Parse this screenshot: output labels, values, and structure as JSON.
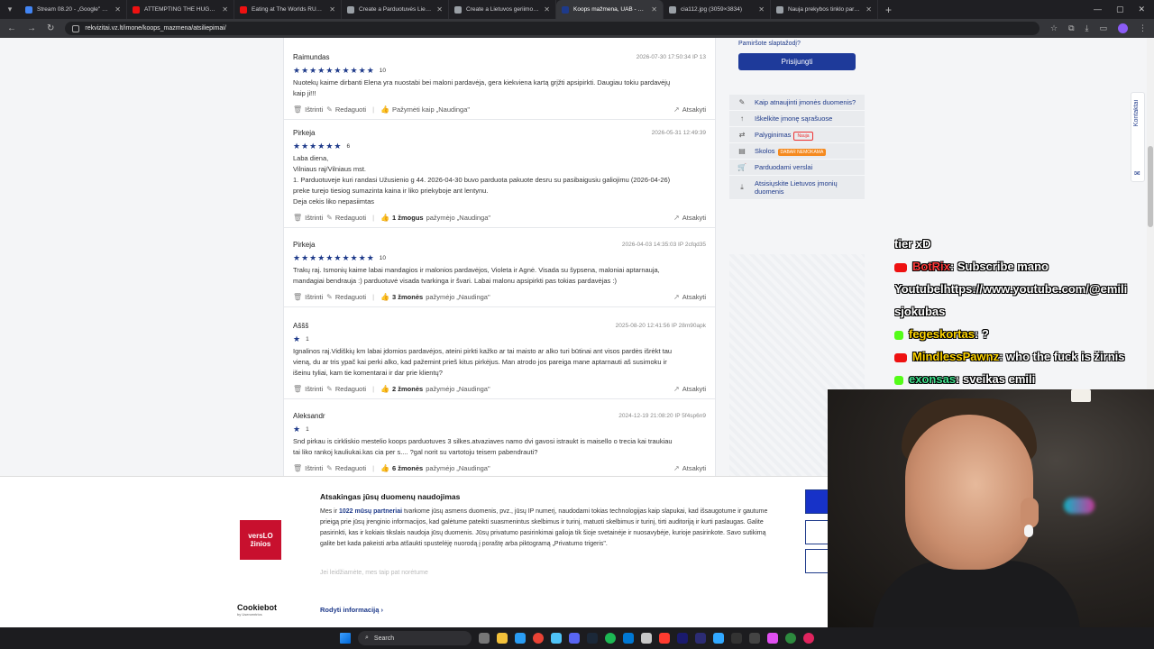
{
  "browser": {
    "tabs": [
      {
        "title": "Stream 08.20 - „Google\" dokum",
        "color": "#4285f4",
        "active": false
      },
      {
        "title": "ATTEMPTING THE HUGE EATIN",
        "color": "#e11",
        "active": false
      },
      {
        "title": "Eating at The Worlds RUDEST R",
        "color": "#e11",
        "active": false
      },
      {
        "title": "Create a Parduotuvės Lietuvoje",
        "color": "#9aa0a6",
        "active": false
      },
      {
        "title": "Create a Lietuvos geriimo Tier Li",
        "color": "#9aa0a6",
        "active": false
      },
      {
        "title": "Koops mažmena, UAB - atsilie",
        "color": "#1e3a8a",
        "active": true
      },
      {
        "title": "cia112.jpg (3059×3834)",
        "color": "#9aa0a6",
        "active": false
      },
      {
        "title": "Nauja prekybos tinklo parduot",
        "color": "#9aa0a6",
        "active": false
      }
    ],
    "url": "rekvizitai.vz.lt/imone/koops_mazmena/atsiliepimai/"
  },
  "reviews": [
    {
      "name": "Raimundas",
      "date": "2026-07-30 17:50:34",
      "ip": "IP 13",
      "stars": 10,
      "score": "10",
      "text": "Nuotekų kaime dirbanti Elena yra nuostabi bei maloni pardavėja, gera kiekviena kartą grįžti apsipirkti. Daugiau tokiu pardavėjų\nkaip ji!!!",
      "helpful_count": "",
      "helpful_text": "Pažymėti kaip „Naudinga\""
    },
    {
      "name": "Pirkeja",
      "date": "2026-05-31 12:49:39",
      "ip": "",
      "stars": 6,
      "score": "6",
      "text": "Laba diena,\nVilniaus raj/Vilniaus mst.\n1. Parduotuveje kuri randasi Užusienio g 44. 2026-04-30 buvo parduota pakuote desru su pasibaigusiu galiojimu (2026-04-26)\npreke turejo tiesiog sumazinta kaina ir liko priekyboje ant lentynu.\nDeja cekis liko nepasiimtas",
      "helpful_count": "1 žmogus",
      "helpful_text": "pažymėjo „Naudinga\""
    },
    {
      "name": "Pirkeja",
      "date": "2026-04-03 14:35:03",
      "ip": "IP 2cfqd35",
      "stars": 10,
      "score": "10",
      "text": "Trakų raj. Ismonių kaime labai mandagios ir malonios pardavėjos, Violeta ir Agnė. Visada su šypsena, maloniai aptarnauja,\nmandagiai bendrauja :) parduotuvė visada tvarkinga ir švari. Labai malonu apsipirkti pas tokias pardavėjas :)",
      "helpful_count": "3 žmonės",
      "helpful_text": "pažymėjo „Naudinga\""
    },
    {
      "name": "Aššš",
      "date": "2025-08-20 12:41:56",
      "ip": "IP 28m90apk",
      "stars": 1,
      "score": "1",
      "text": "Ignalinos raj.Vidiškių km labai įdomios pardavėjos, ateini pirkti kažko ar tai maisto ar alko turi būtinai ant visos pardės išrėkt tau\nvieną, du ar tris ypač kai perki alko, kad pažemint prieš kitus pirkėjus. Man atrodo jos pareiga mane aptarnauti aš susimoku ir\nišeinu tyliai, kam tie komentarai ir dar prie klientų?",
      "helpful_count": "2 žmonės",
      "helpful_text": "pažymėjo „Naudinga\""
    },
    {
      "name": "Aleksandr",
      "date": "2024-12-19 21:08:20",
      "ip": "IP 5f4sp6n9",
      "stars": 1,
      "score": "1",
      "text": "Snd pirkau is cirkliskio mestelio koops parduotuves 3 silkes.atvaziaves namo dvi gavosi istraukt is maisello o trecia kai traukiau\ntai liko rankoj kauliukai.kas cia per s.... ?gal norit su vartotoju teisem pabendrauti?",
      "helpful_count": "6 žmonės",
      "helpful_text": "pažymėjo „Naudinga\""
    }
  ],
  "actions": {
    "delete": "Ištrinti",
    "edit": "Redaguoti",
    "reply": "Atsakyti"
  },
  "sidebar": {
    "forgot": "Pamiršote slaptažodį?",
    "login": "Prisijungti",
    "menu": [
      {
        "label": "Kaip atnaujinti įmonės duomenis?",
        "icon": "pencil-icon",
        "badge": ""
      },
      {
        "label": "Iškelkite įmonę sąrašuose",
        "icon": "arrow-up-icon",
        "badge": ""
      },
      {
        "label": "Palyginimas",
        "icon": "compare-icon",
        "badge": "Nauja"
      },
      {
        "label": "Skolos",
        "icon": "debt-icon",
        "badge": "DABAR NEMOKAMA"
      },
      {
        "label": "Parduodami verslai",
        "icon": "cart-icon",
        "badge": ""
      },
      {
        "label": "Atsisiųskite Lietuvos įmonių duomenis",
        "icon": "download-icon",
        "badge": ""
      }
    ],
    "kontaktai": "Kontaktai"
  },
  "chat": [
    {
      "platform": "",
      "user": "",
      "user_color": "#ffffff",
      "message": "tier xD"
    },
    {
      "platform": "youtube",
      "user": "BotRix",
      "user_color": "#ff3a3a",
      "message": ": Subscribe mano"
    },
    {
      "platform": "",
      "user": "",
      "user_color": "#ffffff",
      "message": "Youtubelhttps://www.youtube.com/@emili"
    },
    {
      "platform": "",
      "user": "",
      "user_color": "#ffffff",
      "message": "sjokubas"
    },
    {
      "platform": "kick",
      "user": "fegeskortas",
      "user_color": "#ffd400",
      "message": ": ?"
    },
    {
      "platform": "youtube",
      "user": "MindlessPawnz",
      "user_color": "#ffd400",
      "message": ": who the fuck is žirnis"
    },
    {
      "platform": "kick",
      "user": "exonsas",
      "user_color": "#3ee08c",
      "message": ": sveikas emili"
    }
  ],
  "cookie": {
    "logo_line1": "versLO",
    "logo_line2": "žinios",
    "title": "Atsakingas jūsų duomenų naudojimas",
    "text_pre": "Mes ir ",
    "text_link": "1022 mūsų partneriai",
    "text_post": " tvarkome jūsų asmens duomenis, pvz., jūsų IP numerį, naudodami tokias technologijas kaip slapukai, kad išsaugotume ir gautume prieigą prie jūsų įrenginio informacijos, kad galėtume pateikti suasmenintus skelbimus ir turinį, matuoti skelbimus ir turinį, tirti auditoriją ir kurti paslaugas. Galite pasirinkti, kas ir kokiais tikslais naudoja jūsų duomenis. Jūsų privatumo pasirinkimai galioja tik šioje svetainėje ir nuosavybėje, kurioje pasirinkote. Savo sutikimą galite bet kada pakeisti arba atšaukti spustelėję nuorodą į poraštę arba piktogramą „Privatumo trigeris\".",
    "fade": "Jei leidžiamėte, mes taip pat norėtume",
    "more": "Rodyti informaciją",
    "cookiebot": "Cookiebot",
    "cookiebot_sub": "by Usercentrics"
  },
  "taskbar": {
    "search": "Search"
  }
}
